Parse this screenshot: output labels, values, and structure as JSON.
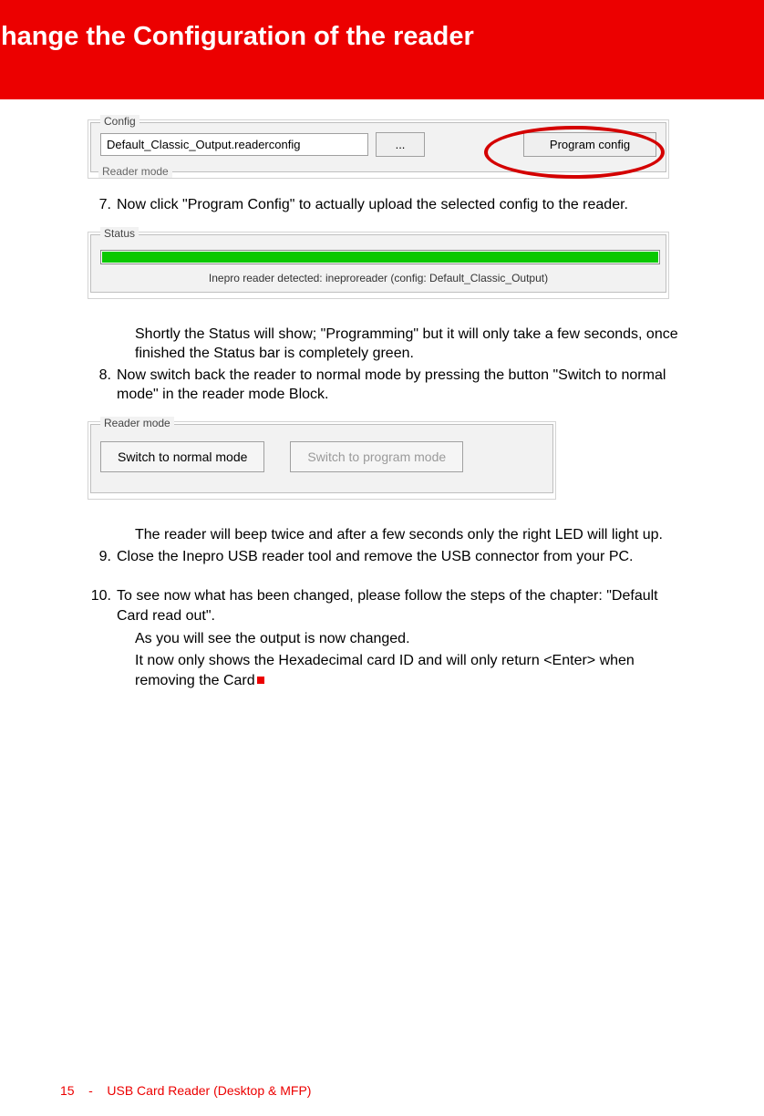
{
  "header": {
    "title": "Change the Configuration of the reader"
  },
  "figures": {
    "config": {
      "legend": "Config",
      "textbox_value": "Default_Classic_Output.readerconfig",
      "browse_label": "...",
      "program_label": "Program config",
      "cut_legend": "Reader mode"
    },
    "status": {
      "legend": "Status",
      "text": "Inepro reader detected: ineproreader (config: Default_Classic_Output)"
    },
    "reader_mode": {
      "legend": "Reader mode",
      "normal_label": "Switch to normal mode",
      "program_label": "Switch to program mode"
    }
  },
  "steps": {
    "s7": {
      "num": "7.",
      "text": "Now click \"Program Config\" to actually upload the selected config to the reader."
    },
    "s7_note": "Shortly the Status will show; \"Programming\" but it will only take a few seconds, once finished the Status bar is completely green.",
    "s8": {
      "num": "8.",
      "text": "Now switch back the reader to normal mode by pressing the button \"Switch to normal mode\" in the reader mode Block."
    },
    "s8_note": "The reader will beep twice and after a few seconds only the right LED will light up.",
    "s9": {
      "num": "9.",
      "text": "Close the Inepro USB reader tool and remove the USB connector from your PC."
    },
    "s10": {
      "num": "10.",
      "text": "To see now what has been changed, please follow the steps of the chapter: \"Default Card read out\"."
    },
    "s10_note1": "As you will see the output is now changed.",
    "s10_note2": "It now only shows the Hexadecimal card ID and will only return <Enter> when removing the Card"
  },
  "footer": {
    "page_number": "15",
    "sep": "-",
    "doc_title": "USB Card Reader (Desktop & MFP)"
  }
}
